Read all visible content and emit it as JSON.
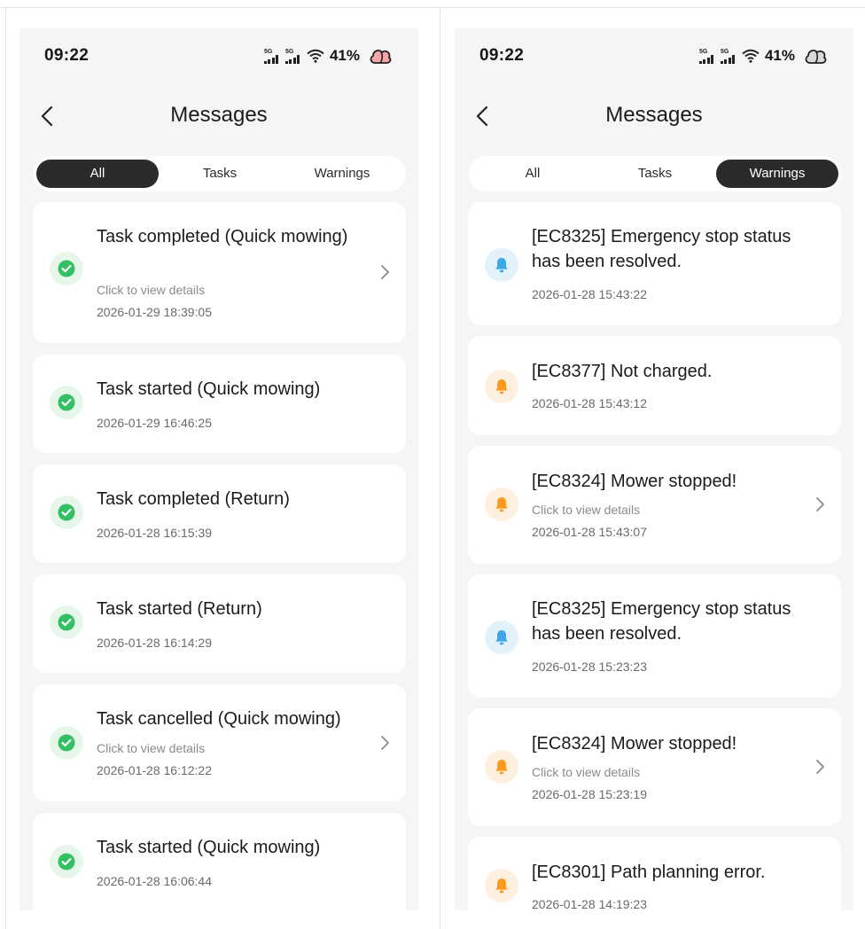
{
  "left": {
    "status": {
      "time": "09:22",
      "network1": "5G",
      "network2": "5G",
      "battery": "41%"
    },
    "header": {
      "title": "Messages"
    },
    "tabs": [
      "All",
      "Tasks",
      "Warnings"
    ],
    "active_tab": "All",
    "messages": [
      {
        "title": "Task completed (Quick mowing)",
        "subtitle": "Click to view details",
        "time": "2026-01-29 18:39:05",
        "icon": "check-circle-icon",
        "has_chevron": true
      },
      {
        "title": "Task started (Quick mowing)",
        "time": "2026-01-29 16:46:25",
        "icon": "check-circle-icon",
        "has_chevron": false
      },
      {
        "title": "Task completed (Return)",
        "time": "2026-01-28 16:15:39",
        "icon": "check-circle-icon",
        "has_chevron": false
      },
      {
        "title": "Task started (Return)",
        "time": "2026-01-28 16:14:29",
        "icon": "check-circle-icon",
        "has_chevron": false
      },
      {
        "title": "Task cancelled (Quick mowing)",
        "subtitle": "Click to view details",
        "time": "2026-01-28 16:12:22",
        "icon": "check-circle-icon",
        "has_chevron": true
      },
      {
        "title": "Task started (Quick mowing)",
        "time": "2026-01-28 16:06:44",
        "icon": "check-circle-icon",
        "has_chevron": false
      }
    ]
  },
  "right": {
    "status": {
      "time": "09:22",
      "network1": "5G",
      "network2": "5G",
      "battery": "41%"
    },
    "header": {
      "title": "Messages"
    },
    "tabs": [
      "All",
      "Tasks",
      "Warnings"
    ],
    "active_tab": "Warnings",
    "messages": [
      {
        "title": "[EC8325] Emergency stop status has been resolved.",
        "time": "2026-01-28 15:43:22",
        "icon": "bell-icon",
        "icon_color": "blue",
        "has_chevron": false
      },
      {
        "title": "[EC8377] Not charged.",
        "time": "2026-01-28 15:43:12",
        "icon": "bell-icon",
        "icon_color": "orange",
        "has_chevron": false
      },
      {
        "title": "[EC8324] Mower stopped!",
        "subtitle": "Click to view details",
        "time": "2026-01-28 15:43:07",
        "icon": "bell-icon",
        "icon_color": "orange",
        "has_chevron": true
      },
      {
        "title": "[EC8325] Emergency stop status has been resolved.",
        "time": "2026-01-28 15:23:23",
        "icon": "bell-icon",
        "icon_color": "blue",
        "has_chevron": false
      },
      {
        "title": "[EC8324] Mower stopped!",
        "subtitle": "Click to view details",
        "time": "2026-01-28 15:23:19",
        "icon": "bell-icon",
        "icon_color": "orange",
        "has_chevron": true
      },
      {
        "title": "[EC8301] Path planning error.",
        "time": "2026-01-28 14:19:23",
        "icon": "bell-icon",
        "icon_color": "orange",
        "has_chevron": false
      }
    ]
  },
  "colors": {
    "background": "#f4f5f4",
    "card": "#ffffff",
    "active_tab": "#2b2b2b",
    "success_green": "#34c062",
    "info_blue": "#3ea7ea",
    "warning_orange": "#ff9a1f"
  }
}
